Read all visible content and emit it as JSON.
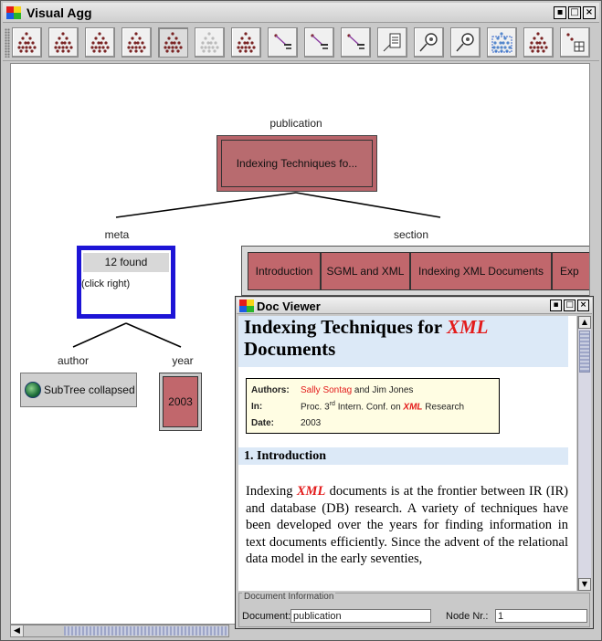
{
  "main_window": {
    "title": "Visual Agg",
    "controls": [
      "▪",
      "□",
      "×"
    ]
  },
  "toolbar": {
    "buttons": [
      {
        "name": "tree-view-1",
        "icon": "tree-icon",
        "pressed": false
      },
      {
        "name": "tree-view-2",
        "icon": "tree-icon",
        "pressed": false
      },
      {
        "name": "tree-view-3",
        "icon": "tree-icon",
        "pressed": false
      },
      {
        "name": "tree-view-4",
        "icon": "tree-icon",
        "pressed": false
      },
      {
        "name": "tree-view-5",
        "icon": "tree-icon",
        "pressed": true
      },
      {
        "name": "tree-view-6",
        "icon": "tree-outline-icon",
        "pressed": false
      },
      {
        "name": "tree-view-7",
        "icon": "tree-icon",
        "pressed": false
      },
      {
        "name": "path-tool-1",
        "icon": "diagonal-path-icon",
        "pressed": false
      },
      {
        "name": "path-tool-2",
        "icon": "diagonal-path-icon",
        "pressed": false
      },
      {
        "name": "path-tool-3",
        "icon": "diagonal-path-icon",
        "pressed": false
      },
      {
        "name": "document-tool",
        "icon": "document-icon",
        "pressed": false
      },
      {
        "name": "search-tool-1",
        "icon": "magnifier-icon",
        "pressed": false
      },
      {
        "name": "search-tool-2",
        "icon": "magnifier-icon",
        "pressed": false
      },
      {
        "name": "select-tool",
        "icon": "select-tree-icon",
        "pressed": false
      },
      {
        "name": "tree-view-8",
        "icon": "tree-icon",
        "pressed": false
      },
      {
        "name": "grid-tool",
        "icon": "grid-icon",
        "pressed": false
      }
    ]
  },
  "tree": {
    "root": {
      "label": "publication",
      "box_text": "Indexing Techniques fo..."
    },
    "meta": {
      "label": "meta",
      "found_text": "12 found",
      "hint_text": "(click right)"
    },
    "section": {
      "label": "section",
      "items": [
        "Introduction",
        "SGML and XML",
        "Indexing XML Documents",
        "Exp"
      ]
    },
    "author": {
      "label": "author",
      "collapsed_text": "SubTree collapsed"
    },
    "year": {
      "label": "year",
      "value": "2003"
    }
  },
  "doc_viewer": {
    "title": "Doc Viewer",
    "controls": [
      "▪",
      "□",
      "×"
    ],
    "heading_pre": "Indexing Techniques for ",
    "heading_xml": "XML",
    "heading_post": "Documents",
    "meta": {
      "authors_key": "Authors:",
      "author1": "Sally Sontag",
      "and_text": " and Jim Jones",
      "in_key": "In:",
      "in_pre": "Proc. 3",
      "in_sup": "rd",
      "in_mid": " Intern. Conf. on ",
      "in_xml": "XML",
      "in_post": " Research",
      "date_key": "Date:",
      "date_value": "2003"
    },
    "section_heading": "1. Introduction",
    "paragraph_pre": "Indexing ",
    "paragraph_xml": "XML",
    "paragraph_post": " documents is at the frontier between IR (IR) and database (DB) research. A variety of techniques have been developed over the years for finding information in text documents efficiently. Since the advent of the relational data model in the early seventies,",
    "info": {
      "legend": "Document Information",
      "document_label": "Document:",
      "document_value": "publication",
      "node_label": "Node Nr.:",
      "node_value": "1"
    }
  },
  "colors": {
    "node_fill": "#c1676c",
    "selection_border": "#1d14d6",
    "xml_highlight": "#e31b1b",
    "heading_bg": "#dce9f7"
  }
}
